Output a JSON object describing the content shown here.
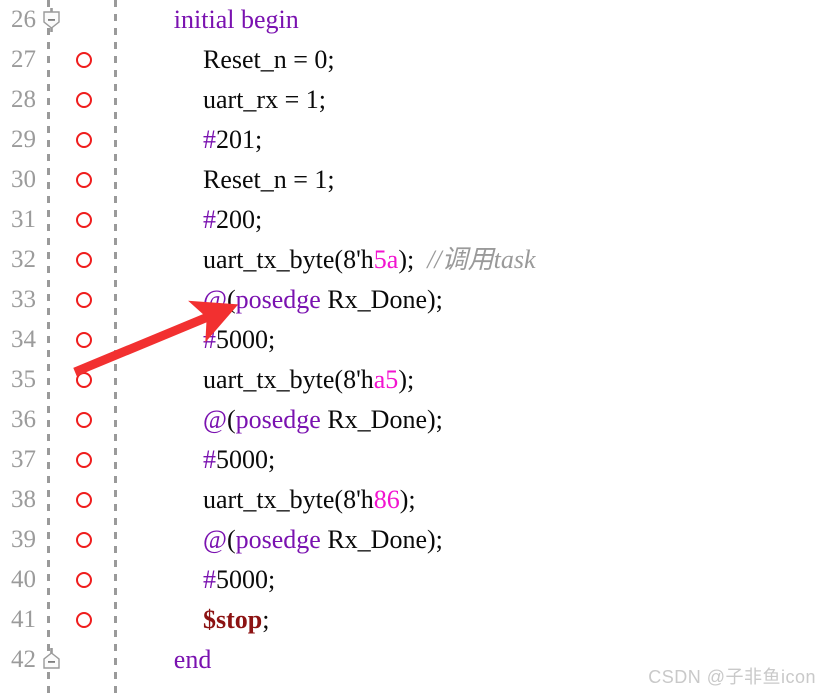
{
  "editor": {
    "language": "verilog",
    "first_line": 26,
    "line_height": 40,
    "colors": {
      "background": "#ffffff",
      "line_number": "#9b9b9b",
      "plain_text": "#0a0a0a",
      "keyword": "#7a12b0",
      "hex_literal": "#f213d0",
      "system_task": "#8c1212",
      "comment": "#9a9a9a",
      "breakpoint": "#ef1d1d",
      "guide_dash": "#9a9a9a",
      "annotation_arrow": "#f23030",
      "watermark": "#c9c9c9"
    }
  },
  "lines": [
    {
      "number": "26",
      "fold": "collapse-down",
      "breakpoint": false,
      "indent": 3,
      "tokens": [
        {
          "t": "initial begin",
          "c": "kw"
        }
      ]
    },
    {
      "number": "27",
      "fold": null,
      "breakpoint": true,
      "indent": 5,
      "tokens": [
        {
          "t": "Reset_n = 0;",
          "c": "pl"
        }
      ]
    },
    {
      "number": "28",
      "fold": null,
      "breakpoint": true,
      "indent": 5,
      "tokens": [
        {
          "t": "uart_rx = 1;",
          "c": "pl"
        }
      ]
    },
    {
      "number": "29",
      "fold": null,
      "breakpoint": true,
      "indent": 5,
      "tokens": [
        {
          "t": "#",
          "c": "kw"
        },
        {
          "t": "201;",
          "c": "pl"
        }
      ]
    },
    {
      "number": "30",
      "fold": null,
      "breakpoint": true,
      "indent": 5,
      "tokens": [
        {
          "t": "Reset_n = 1;",
          "c": "pl"
        }
      ]
    },
    {
      "number": "31",
      "fold": null,
      "breakpoint": true,
      "indent": 5,
      "tokens": [
        {
          "t": "#",
          "c": "kw"
        },
        {
          "t": "200;",
          "c": "pl"
        }
      ]
    },
    {
      "number": "32",
      "fold": null,
      "breakpoint": true,
      "indent": 5,
      "tokens": [
        {
          "t": "uart_tx_byte(8'h",
          "c": "pl"
        },
        {
          "t": "5a",
          "c": "hex"
        },
        {
          "t": ");  ",
          "c": "pl"
        },
        {
          "t": "//调用task",
          "c": "cmt"
        }
      ]
    },
    {
      "number": "33",
      "fold": null,
      "breakpoint": true,
      "indent": 5,
      "tokens": [
        {
          "t": "@",
          "c": "kw"
        },
        {
          "t": "(",
          "c": "pl"
        },
        {
          "t": "posedge",
          "c": "kw"
        },
        {
          "t": " Rx_Done);",
          "c": "pl"
        }
      ]
    },
    {
      "number": "34",
      "fold": null,
      "breakpoint": true,
      "indent": 5,
      "tokens": [
        {
          "t": "#",
          "c": "kw"
        },
        {
          "t": "5000;",
          "c": "pl"
        }
      ]
    },
    {
      "number": "35",
      "fold": null,
      "breakpoint": true,
      "indent": 5,
      "tokens": [
        {
          "t": "uart_tx_byte(8'h",
          "c": "pl"
        },
        {
          "t": "a5",
          "c": "hex"
        },
        {
          "t": ");",
          "c": "pl"
        }
      ]
    },
    {
      "number": "36",
      "fold": null,
      "breakpoint": true,
      "indent": 5,
      "tokens": [
        {
          "t": "@",
          "c": "kw"
        },
        {
          "t": "(",
          "c": "pl"
        },
        {
          "t": "posedge",
          "c": "kw"
        },
        {
          "t": " Rx_Done);",
          "c": "pl"
        }
      ]
    },
    {
      "number": "37",
      "fold": null,
      "breakpoint": true,
      "indent": 5,
      "tokens": [
        {
          "t": "#",
          "c": "kw"
        },
        {
          "t": "5000;",
          "c": "pl"
        }
      ]
    },
    {
      "number": "38",
      "fold": null,
      "breakpoint": true,
      "indent": 5,
      "tokens": [
        {
          "t": "uart_tx_byte(8'h",
          "c": "pl"
        },
        {
          "t": "86",
          "c": "hex"
        },
        {
          "t": ");",
          "c": "pl"
        }
      ]
    },
    {
      "number": "39",
      "fold": null,
      "breakpoint": true,
      "indent": 5,
      "tokens": [
        {
          "t": "@",
          "c": "kw"
        },
        {
          "t": "(",
          "c": "pl"
        },
        {
          "t": "posedge",
          "c": "kw"
        },
        {
          "t": " Rx_Done);",
          "c": "pl"
        }
      ]
    },
    {
      "number": "40",
      "fold": null,
      "breakpoint": true,
      "indent": 5,
      "tokens": [
        {
          "t": "#",
          "c": "kw"
        },
        {
          "t": "5000;",
          "c": "pl"
        }
      ]
    },
    {
      "number": "41",
      "fold": null,
      "breakpoint": true,
      "indent": 5,
      "tokens": [
        {
          "t": "$stop",
          "c": "sys"
        },
        {
          "t": ";",
          "c": "pl"
        }
      ]
    },
    {
      "number": "42",
      "fold": "collapse-up",
      "breakpoint": false,
      "indent": 3,
      "tokens": [
        {
          "t": "end",
          "c": "kw"
        }
      ]
    }
  ],
  "annotation": {
    "type": "arrow",
    "label": "red-pointer-arrow",
    "points_to_line": "33"
  },
  "watermark": {
    "text": "CSDN @子非鱼icon"
  }
}
